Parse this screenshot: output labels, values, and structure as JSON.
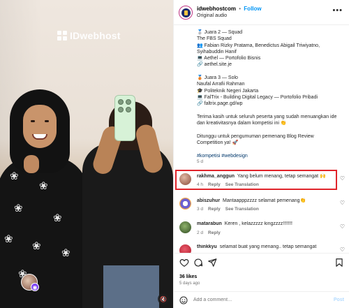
{
  "media": {
    "watermark": "IDwebhost",
    "video_icons": {
      "avatar": "user-avatar",
      "badge": "reel-badge-icon",
      "mute": "muted-speaker-icon"
    }
  },
  "header": {
    "username": "idwebhostcom",
    "separator": "•",
    "follow_label": "Follow",
    "audio": "Original audio",
    "more_icon": "more-horizontal-icon"
  },
  "caption": {
    "lines": [
      "🥈 Juara 2 — Squad",
      "The FBS Squad",
      "👥 Fabian Rizky Pratama, Benedictus Abigail Triwiyatno,",
      "Syihabuddin Hanif",
      "💻 Aethel — Portofolio Bisnis",
      "🔗 aethel.site.je",
      "",
      "🥉 Juara 3 — Solo",
      "Naufal Arrafii Rahman",
      "🎓 Politeknik Negeri Jakarta",
      "💻 FalTrix - Building Digital Legacy — Portofolio Pribadi",
      "🔗 faltrix.page.gd/wp",
      "",
      "Terima kasih untuk seluruh peserta yang sudah menuangkan ide",
      "dan kreativitasnya dalam kompetisi ini 👏",
      "",
      "Ditunggu untuk pengumuman pemenang Blog Review",
      "Competition ya! 🚀",
      ""
    ],
    "hashtags": "#kompetisi #webdesign",
    "time": "5 d"
  },
  "comments": [
    {
      "username": "rakhma_anggun",
      "text": "Yang belum menang, tetap semangat 🙌",
      "time": "4 h",
      "reply": "Reply",
      "see_translation": "See Translation",
      "avatar_color": "#8a4b3b"
    },
    {
      "username": "abiszuhur",
      "text": "Mantaapppzzzz selamat pemenang👏",
      "time": "3 d",
      "reply": "Reply",
      "see_translation": "See Translation",
      "avatar_color": "#6b5fd0"
    },
    {
      "username": "matarabun",
      "text": "Keren , kelazzzzz kingzzzz!!!!!!!",
      "time": "2 d",
      "reply": "Reply",
      "see_translation": "",
      "avatar_color": "#3f5f2f"
    },
    {
      "username": "thinkkyu",
      "text": "selamat buat yang menang.. tetap semangat",
      "time": "",
      "reply": "",
      "see_translation": "",
      "avatar_color": "#b11a2b"
    }
  ],
  "actions": {
    "icons": [
      "heart-icon",
      "comment-icon",
      "share-icon",
      "bookmark-icon"
    ],
    "likes": "36 likes",
    "ago": "5 days ago",
    "add_comment_placeholder": "Add a comment…",
    "post_label": "Post",
    "emoji_icon": "emoji-icon"
  },
  "colors": {
    "follow": "#0095f6",
    "highlight": "#e0242b",
    "post_disabled": "#b3dbff",
    "hashtag": "#00376b"
  }
}
